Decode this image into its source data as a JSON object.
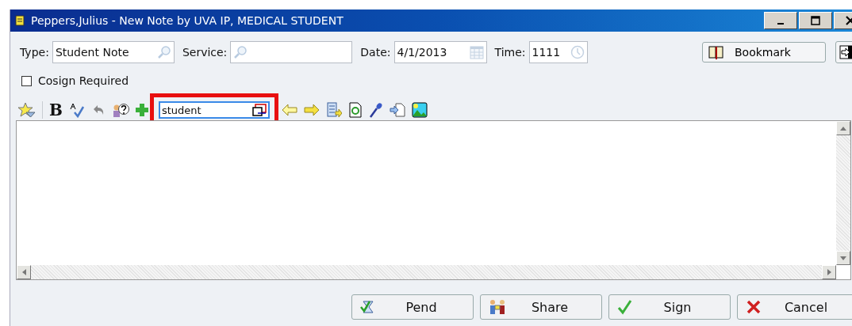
{
  "window": {
    "title": "Peppers,Julius - New Note by UVA IP, MEDICAL STUDENT"
  },
  "fields": [
    {
      "label": "Type:",
      "value": "Student Note",
      "kind": "lookup"
    },
    {
      "label": "Service:",
      "kind": "lookup"
    },
    {
      "label": "Date:",
      "value": "4/1/2013",
      "kind": "date"
    },
    {
      "label": "Time:",
      "value": "1111",
      "kind": "time"
    }
  ],
  "bookmark_button": "Bookmark",
  "cosign": {
    "label": "Cosign Required",
    "checked": false
  },
  "toolbar": {
    "bold": "B",
    "template_field": {
      "value": "student"
    }
  },
  "buttons": [
    {
      "label": "Pend",
      "kind": "pend"
    },
    {
      "label": "Share",
      "kind": "share"
    },
    {
      "label": "Sign",
      "kind": "sign"
    },
    {
      "label": "Cancel",
      "kind": "cancel"
    }
  ]
}
